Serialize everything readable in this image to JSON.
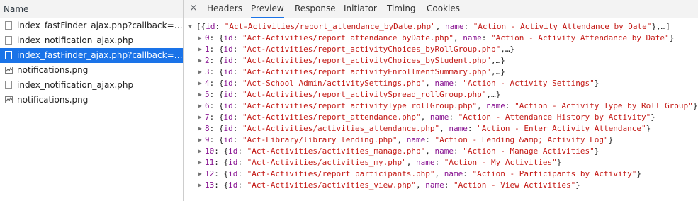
{
  "left": {
    "header": "Name",
    "requests": [
      {
        "name": "index_fastFinder_ajax.php?callback=jQuer...",
        "type": "file"
      },
      {
        "name": "index_notification_ajax.php",
        "type": "file"
      },
      {
        "name": "index_fastFinder_ajax.php?callback=jQuer...",
        "type": "file",
        "selected": true
      },
      {
        "name": "notifications.png",
        "type": "image"
      },
      {
        "name": "index_notification_ajax.php",
        "type": "file"
      },
      {
        "name": "notifications.png",
        "type": "image"
      }
    ]
  },
  "tabs": {
    "close": "×",
    "items": [
      "Headers",
      "Preview",
      "Response",
      "Initiator",
      "Timing",
      "Cookies"
    ],
    "active": "Preview"
  },
  "preview": {
    "root": "[{id: \"Act-Activities/report_attendance_byDate.php\", name: \"Action - Activity Attendance by Date\"},…]",
    "items": [
      {
        "key": "0",
        "text": "{id: \"Act-Activities/report_attendance_byDate.php\", name: \"Action - Activity Attendance by Date\"}"
      },
      {
        "key": "1",
        "text": "{id: \"Act-Activities/report_activityChoices_byRollGroup.php\",…}"
      },
      {
        "key": "2",
        "text": "{id: \"Act-Activities/report_activityChoices_byStudent.php\",…}"
      },
      {
        "key": "3",
        "text": "{id: \"Act-Activities/report_activityEnrollmentSummary.php\",…}"
      },
      {
        "key": "4",
        "text": "{id: \"Act-School Admin/activitySettings.php\", name: \"Action - Activity Settings\"}"
      },
      {
        "key": "5",
        "text": "{id: \"Act-Activities/report_activitySpread_rollGroup.php\",…}"
      },
      {
        "key": "6",
        "text": "{id: \"Act-Activities/report_activityType_rollGroup.php\", name: \"Action - Activity Type by Roll Group\"}"
      },
      {
        "key": "7",
        "text": "{id: \"Act-Activities/report_attendance.php\", name: \"Action - Attendance History by Activity\"}"
      },
      {
        "key": "8",
        "text": "{id: \"Act-Activities/activities_attendance.php\", name: \"Action - Enter Activity Attendance\"}"
      },
      {
        "key": "9",
        "text": "{id: \"Act-Library/library_lending.php\", name: \"Action - Lending &amp; Activity Log\"}"
      },
      {
        "key": "10",
        "text": "{id: \"Act-Activities/activities_manage.php\", name: \"Action - Manage Activities\"}"
      },
      {
        "key": "11",
        "text": "{id: \"Act-Activities/activities_my.php\", name: \"Action - My Activities\"}"
      },
      {
        "key": "12",
        "text": "{id: \"Act-Activities/report_participants.php\", name: \"Action - Participants by Activity\"}"
      },
      {
        "key": "13",
        "text": "{id: \"Act-Activities/activities_view.php\", name: \"Action - View Activities\"}"
      }
    ]
  },
  "colors": {
    "selected_bg": "#1a73e8",
    "key": "#881391",
    "string": "#c41a16",
    "tab_underline": "#1a73e8"
  }
}
